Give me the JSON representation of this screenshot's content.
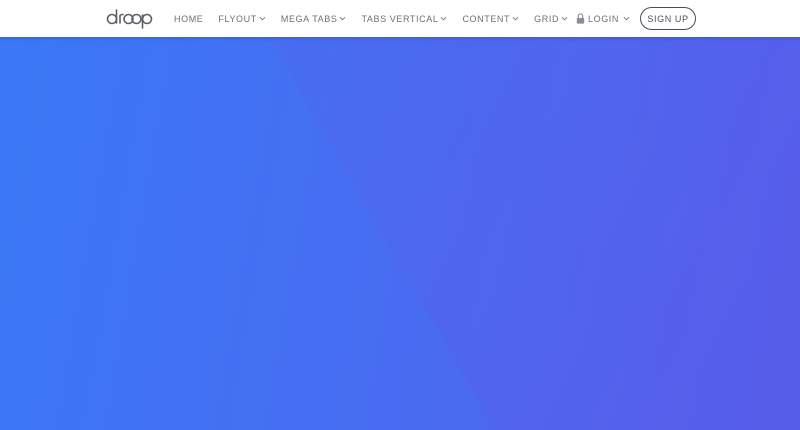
{
  "brand": {
    "logo_text": "droop"
  },
  "nav": {
    "items": [
      {
        "label": "HOME",
        "dropdown": false
      },
      {
        "label": "FLYOUT",
        "dropdown": true
      },
      {
        "label": "MEGA TABS",
        "dropdown": true
      },
      {
        "label": "TABS VERTICAL",
        "dropdown": true
      },
      {
        "label": "CONTENT",
        "dropdown": true
      },
      {
        "label": "GRID",
        "dropdown": true
      }
    ],
    "login_label": "LOGIN",
    "signup_label": "SIGN UP"
  },
  "colors": {
    "hero_start": "#3a78f5",
    "hero_end": "#5360ec",
    "nav_text": "#6b6f76",
    "lock": "#8a8f97"
  },
  "icons": [
    "droop-logo",
    "chevron-down-icon",
    "lock-icon"
  ]
}
